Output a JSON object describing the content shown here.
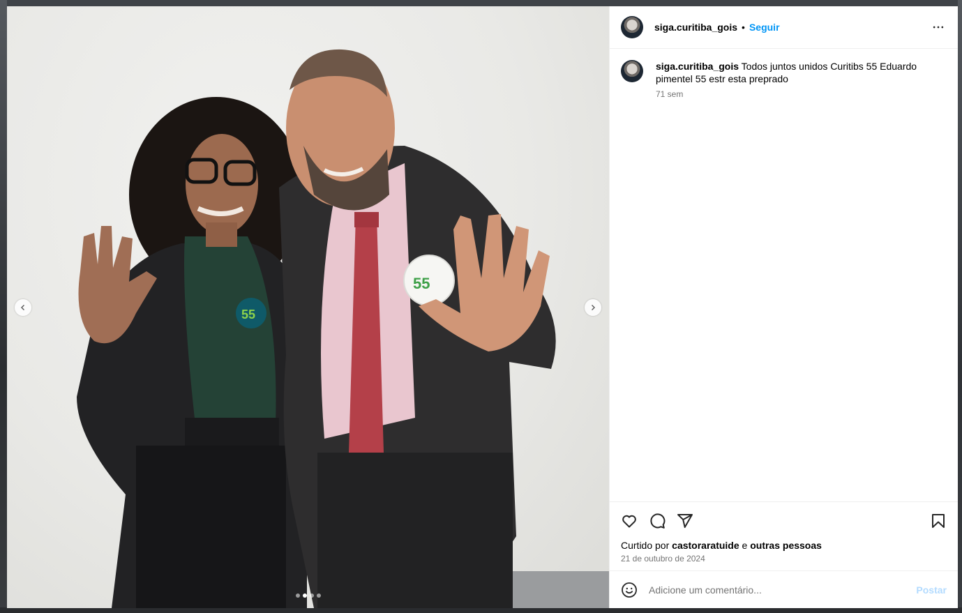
{
  "header": {
    "username": "siga.curitiba_gois",
    "separator": "•",
    "follow_label": "Seguir"
  },
  "caption": {
    "username": "siga.curitiba_gois",
    "text": " Todos juntos unidos Curitibs 55 Eduardo pimentel 55 estr esta preprado",
    "time": "71 sem"
  },
  "photo": {
    "badge_number": "55"
  },
  "carousel": {
    "slide_count": 4,
    "active_index": 1
  },
  "likes": {
    "prefix": "Curtido por ",
    "user": "castoraratuide",
    "middle": " e ",
    "others": "outras pessoas"
  },
  "date": "21 de outubro de 2024",
  "comment_box": {
    "placeholder": "Adicione um comentário...",
    "post_label": "Postar"
  },
  "icons": {
    "like": "heart-icon",
    "comment": "comment-icon",
    "share": "send-icon",
    "save": "bookmark-icon",
    "emoji": "emoji-icon",
    "more": "more-icon",
    "prev": "chevron-left-icon",
    "next": "chevron-right-icon"
  },
  "colors": {
    "link": "#0095f6",
    "post_disabled": "#b3dbff",
    "secondary_text": "#737373"
  }
}
